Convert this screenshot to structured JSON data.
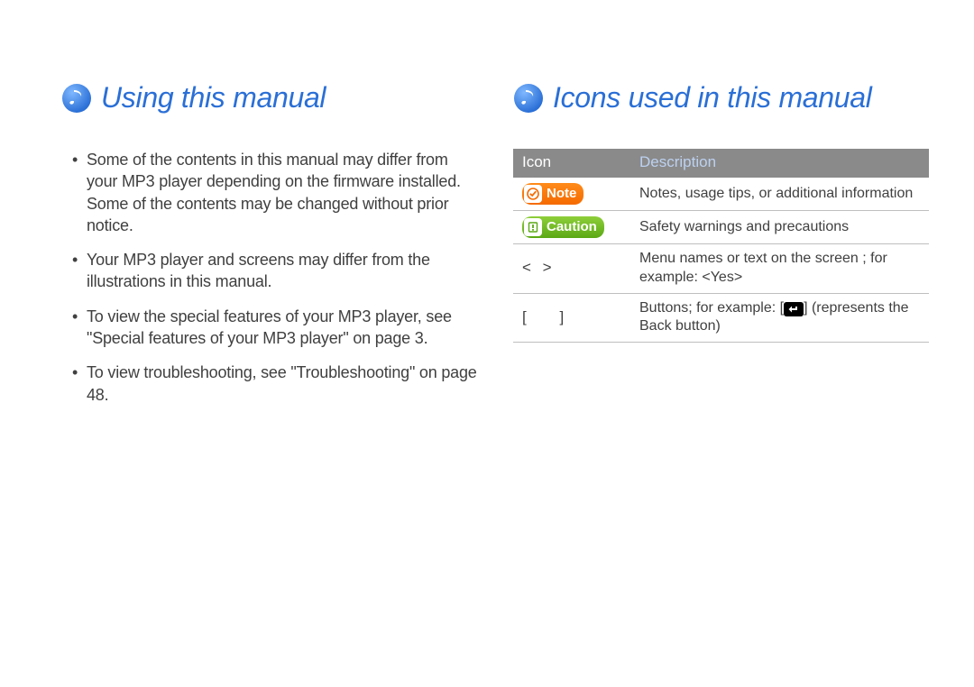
{
  "left": {
    "title": "Using this manual",
    "bullets": [
      "Some of the contents in this manual may differ from your MP3 player depending on the firmware installed. Some of the contents may be changed without prior notice.",
      "Your MP3 player and screens may differ from the illustrations in this manual.",
      "To view the special features of your MP3 player, see \"Special features of your MP3 player\" on page 3.",
      "To view troubleshooting, see \"Troubleshooting\" on page 48."
    ]
  },
  "right": {
    "title": "Icons used in this manual",
    "table": {
      "headers": {
        "icon": "Icon",
        "desc": "Description"
      },
      "rows": [
        {
          "icon_label": "Note",
          "desc": "Notes, usage tips, or additional information"
        },
        {
          "icon_label": "Caution",
          "desc": "Safety warnings and precautions"
        },
        {
          "icon_label": "<  >",
          "desc": "Menu names or text on the screen ; for example: <Yes>"
        },
        {
          "icon_label": "[    ]",
          "desc_pre": "Buttons; for example: [",
          "desc_post": "] (represents the Back button)"
        }
      ]
    }
  }
}
